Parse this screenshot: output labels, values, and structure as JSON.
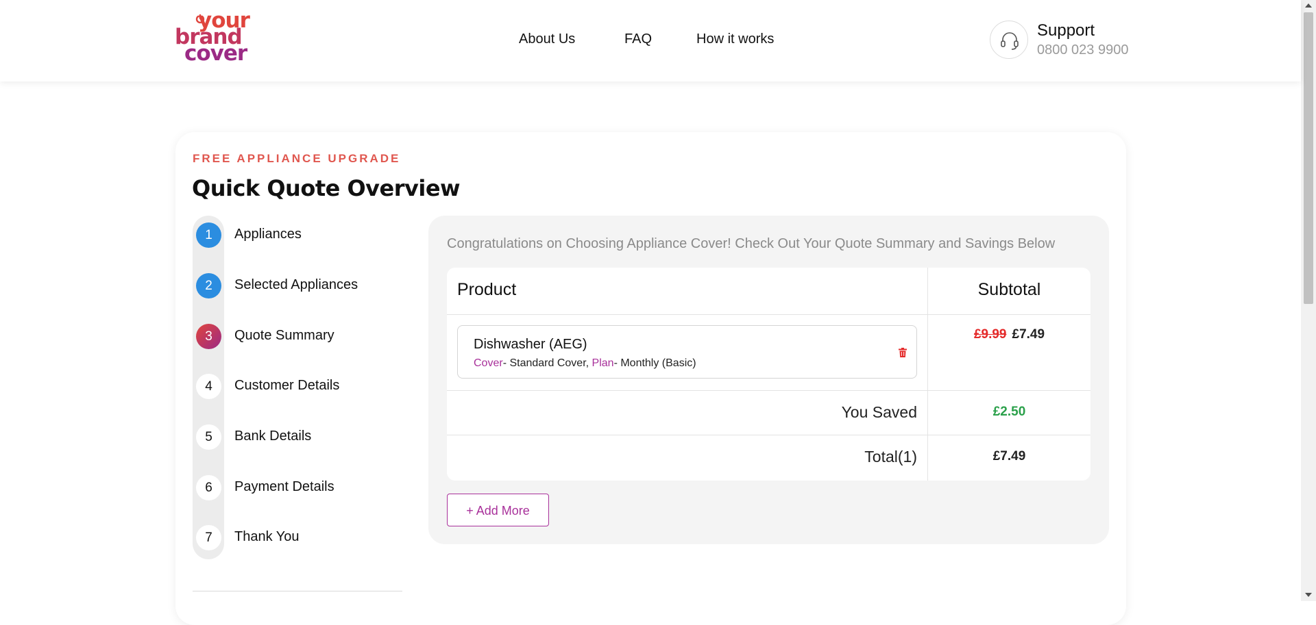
{
  "brand": {
    "logo_line1": "your",
    "logo_line2": "brand",
    "logo_line3": "cover"
  },
  "nav": {
    "about": "About Us",
    "faq": "FAQ",
    "how": "How it works"
  },
  "support": {
    "title": "Support",
    "phone": "0800 023 9900"
  },
  "page": {
    "eyebrow": "FREE APPLIANCE UPGRADE",
    "title": "Quick Quote Overview"
  },
  "steps": [
    {
      "number": "1",
      "label": "Appliances",
      "state": "done"
    },
    {
      "number": "2",
      "label": "Selected Appliances",
      "state": "done"
    },
    {
      "number": "3",
      "label": "Quote Summary",
      "state": "current"
    },
    {
      "number": "4",
      "label": "Customer Details",
      "state": "pending"
    },
    {
      "number": "5",
      "label": "Bank Details",
      "state": "pending"
    },
    {
      "number": "6",
      "label": "Payment Details",
      "state": "pending"
    },
    {
      "number": "7",
      "label": "Thank You",
      "state": "pending"
    }
  ],
  "summary": {
    "intro": "Congratulations on Choosing Appliance Cover! Check Out Your Quote Summary and Savings Below",
    "header_product": "Product",
    "header_subtotal": "Subtotal",
    "item": {
      "name": "Dishwasher (AEG)",
      "cover_label": "Cover",
      "cover_value": "- Standard Cover, ",
      "plan_label": "Plan",
      "plan_value": "- Monthly (Basic)",
      "old_price": "£9.99",
      "new_price": "£7.49"
    },
    "saved_label": "You Saved",
    "saved_value": "£2.50",
    "total_label": "Total(1)",
    "total_value": "£7.49",
    "add_more": "+ Add More"
  },
  "colors": {
    "accent": "#a8309a",
    "brand_red": "#e0453d",
    "step_done": "#2b8de0",
    "saved_green": "#2aa04a",
    "strike_red": "#e42a2a"
  }
}
